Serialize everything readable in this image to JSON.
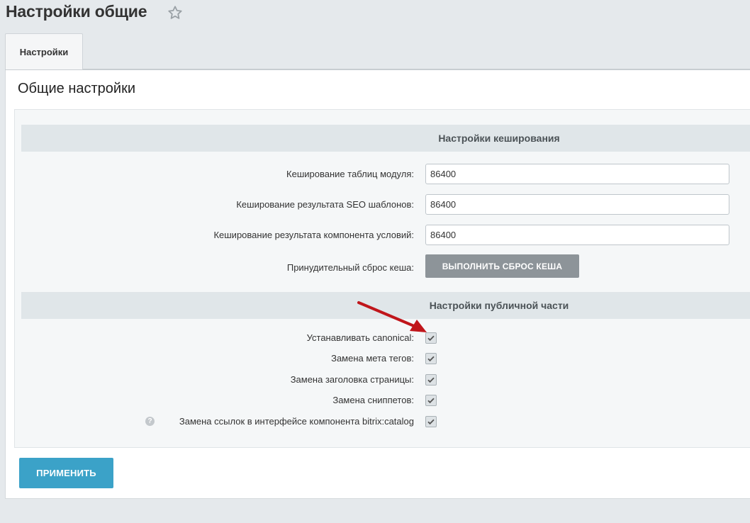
{
  "header": {
    "title": "Настройки общие",
    "star_icon": "star-icon"
  },
  "tabs": [
    {
      "label": "Настройки",
      "active": true
    }
  ],
  "main": {
    "section_title": "Общие настройки",
    "caching": {
      "header": "Настройки кеширования",
      "rows": [
        {
          "label": "Кеширование таблиц модуля:",
          "value": "86400"
        },
        {
          "label": "Кеширование результата SEO шаблонов:",
          "value": "86400"
        },
        {
          "label": "Кеширование результата компонента условий:",
          "value": "86400"
        }
      ],
      "reset_label": "Принудительный сброс кеша:",
      "reset_button": "ВЫПОЛНИТЬ СБРОС КЕША"
    },
    "public": {
      "header": "Настройки публичной части",
      "rows": [
        {
          "label": "Устанавливать canonical:",
          "checked": true
        },
        {
          "label": "Замена мета тегов:",
          "checked": true
        },
        {
          "label": "Замена заголовка страницы:",
          "checked": true
        },
        {
          "label": "Замена сниппетов:",
          "checked": true
        },
        {
          "label": "Замена ссылок в интерфейсе компонента bitrix:catalog",
          "checked": true,
          "help_icon": "?"
        }
      ]
    },
    "apply_button": "ПРИМЕНИТЬ"
  },
  "colors": {
    "accent": "#3ba2c8",
    "annotation_arrow": "#c0161b",
    "group_header_bg": "#e0e6e9"
  }
}
